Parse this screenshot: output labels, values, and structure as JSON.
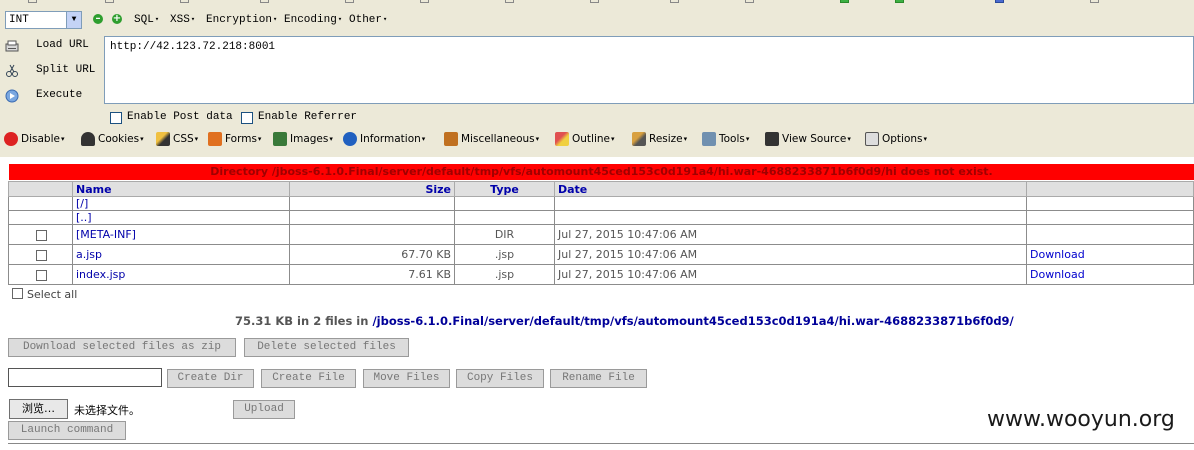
{
  "hackbar": {
    "type_select": "INT",
    "menus": [
      "SQL",
      "XSS",
      "Encryption",
      "Encoding",
      "Other"
    ],
    "load_url": "Load URL",
    "split_url": "Split URL",
    "execute": "Execute",
    "url_value": "http://42.123.72.218:8001",
    "enable_post": "Enable Post data",
    "enable_referrer": "Enable Referrer"
  },
  "webdev": {
    "items": [
      "Disable",
      "Cookies",
      "CSS",
      "Forms",
      "Images",
      "Information",
      "Miscellaneous",
      "Outline",
      "Resize",
      "Tools",
      "View Source",
      "Options"
    ]
  },
  "error_banner": "Directory /jboss-6.1.0.Final/server/default/tmp/vfs/automount45ced153c0d191a4/hi.war-4688233871b6f0d9/hi does not exist.",
  "table": {
    "headers": {
      "name": "Name",
      "size": "Size",
      "type": "Type",
      "date": "Date"
    },
    "rows": [
      {
        "name": "[/]",
        "size": "",
        "type": "",
        "date": "",
        "download": ""
      },
      {
        "name": "[..]",
        "size": "",
        "type": "",
        "date": "",
        "download": ""
      },
      {
        "name": "[META-INF]",
        "size": "",
        "type": "DIR",
        "date": "Jul 27, 2015 10:47:06 AM",
        "download": ""
      },
      {
        "name": "a.jsp",
        "size": "67.70 KB",
        "type": ".jsp",
        "date": "Jul 27, 2015 10:47:06 AM",
        "download": "Download"
      },
      {
        "name": "index.jsp",
        "size": "7.61 KB",
        "type": ".jsp",
        "date": "Jul 27, 2015 10:47:06 AM",
        "download": "Download"
      }
    ]
  },
  "select_all": "Select all",
  "summary": {
    "text": "75.31 KB in 2 files in",
    "path": "/jboss-6.1.0.Final/server/default/tmp/vfs/automount45ced153c0d191a4/hi.war-4688233871b6f0d9/"
  },
  "buttons": {
    "download_zip": "Download selected files as zip",
    "delete_selected": "Delete selected files",
    "create_dir": "Create Dir",
    "create_file": "Create File",
    "move_files": "Move Files",
    "copy_files": "Copy Files",
    "rename_file": "Rename File",
    "browse": "浏览…",
    "no_file": "未选择文件。",
    "upload": "Upload",
    "launch_command": "Launch command"
  },
  "watermark": "www.wooyun.org",
  "colors": {
    "error_red": "#ff0000",
    "link_blue": "#0000aa",
    "toolbar_bg": "#ece9d8"
  }
}
